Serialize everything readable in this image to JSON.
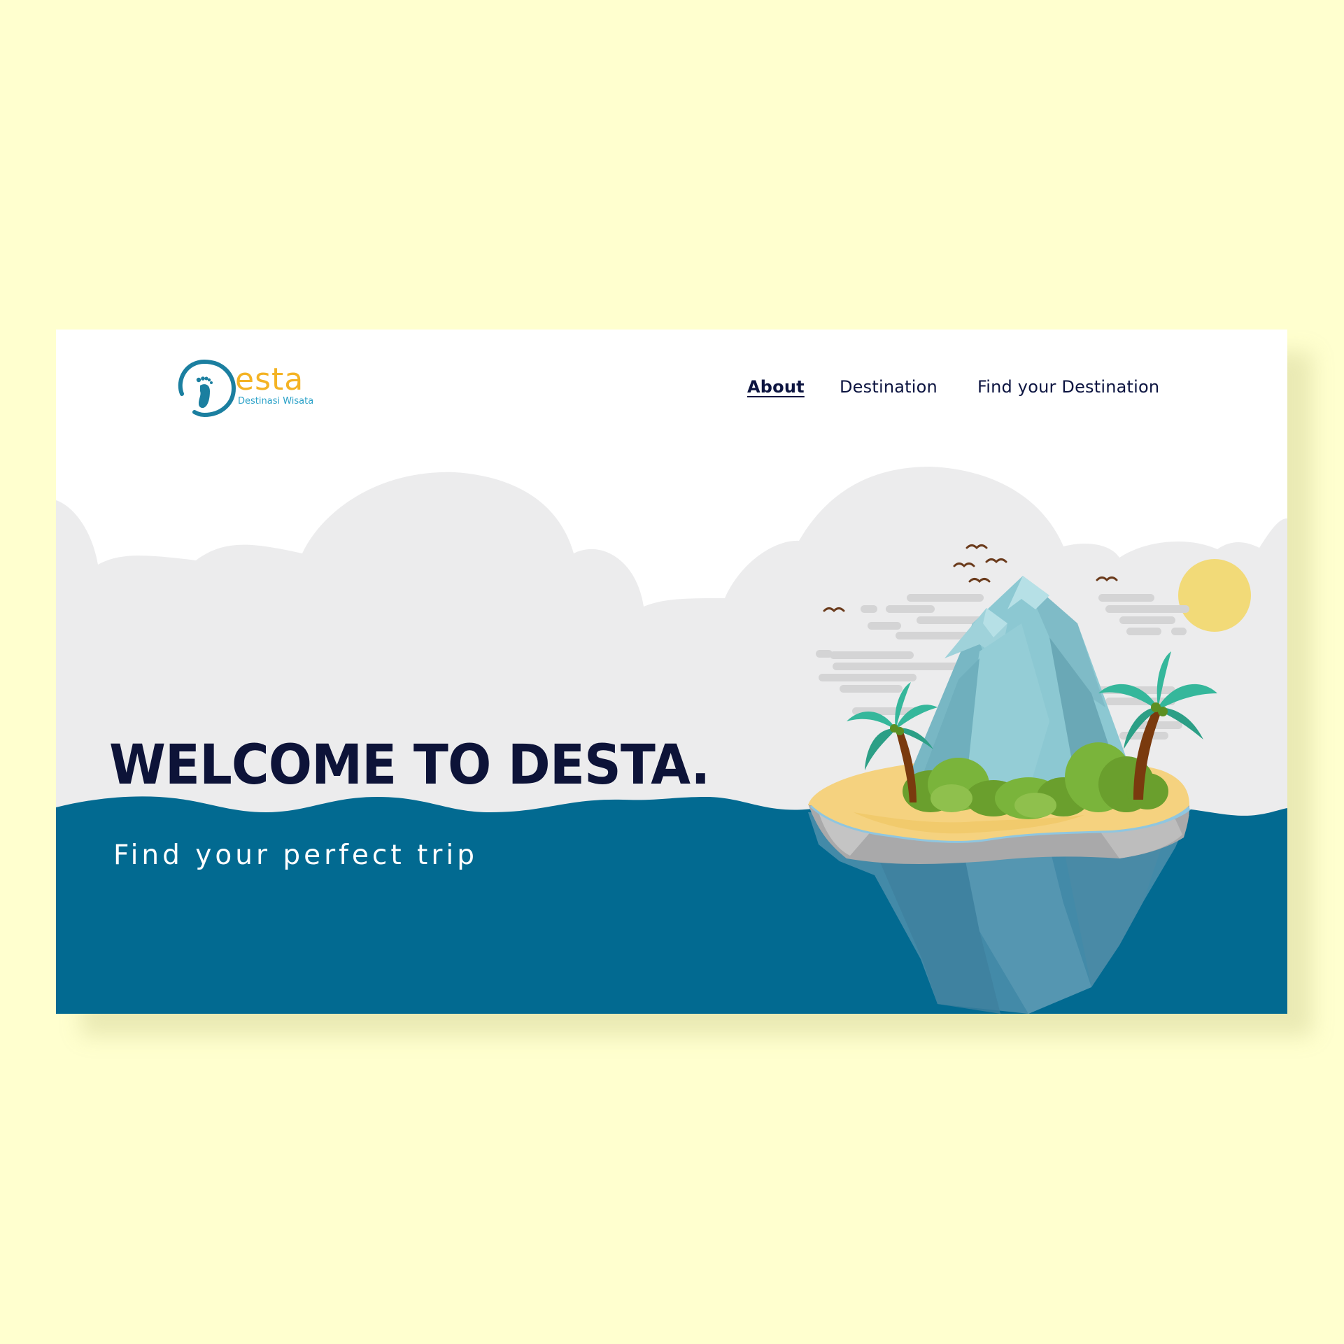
{
  "page": {
    "background_color": "#ffffcf",
    "card_background": "#ffffff"
  },
  "logo": {
    "wordmark": "esta",
    "tagline": "Destinasi Wisata",
    "icon": "footprint-d-icon",
    "colors": {
      "primary": "#1b7fa0",
      "accent": "#f4b324",
      "tagline": "#2aa1c8"
    }
  },
  "nav": {
    "items": [
      {
        "label": "About",
        "active": true
      },
      {
        "label": "Destination",
        "active": false
      },
      {
        "label": "Find your Destination",
        "active": false
      }
    ],
    "text_color": "#0c1440"
  },
  "hero": {
    "title": "WELCOME TO DESTA.",
    "subtitle": "Find your perfect trip",
    "title_color": "#0d1338"
  },
  "illustration": {
    "subject": "tropical island with mountains, palm trees, birds, sun and clouds",
    "colors": {
      "sky_cloud": "#ececed",
      "ocean": "#026a91",
      "sun": "#f2da78",
      "mountain": "#8cc8d2",
      "sand": "#f5d27f",
      "bush": "#7ab43b",
      "palm_leaf": "#35b79b",
      "trunk": "#7a3a0e"
    }
  }
}
